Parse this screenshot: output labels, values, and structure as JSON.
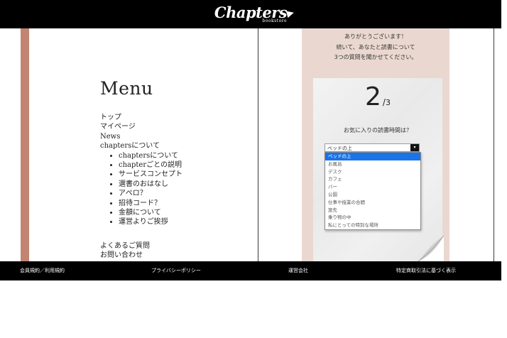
{
  "header": {
    "logo_text": "Chapters",
    "logo_sub": "bookstore"
  },
  "menu": {
    "title": "Menu",
    "items": [
      "トップ",
      "マイページ",
      "News",
      "chaptersについて"
    ],
    "sub_items": [
      "chaptersについて",
      "chapterごとの説明",
      "サービスコンセプト",
      "選書のおはなし",
      "アペロ？",
      "招待コード？",
      "金額について",
      "運営よりご挨拶"
    ],
    "bottom_items": [
      "よくあるご質問",
      "お問い合わせ"
    ]
  },
  "survey": {
    "intro_lines": [
      "ありがとうございます！",
      "続いて、あなたと読書について",
      "3つの質問を聞かせてください。"
    ],
    "step_current": "2",
    "step_sep": "/",
    "step_total": "3",
    "question": "お気に入りの読書時間は？",
    "select_value": "ベッドの上",
    "options": [
      "ベッドの上",
      "お風呂",
      "デスク",
      "カフェ",
      "バー",
      "公園",
      "仕事や授業の合間",
      "旅先",
      "乗り物の中",
      "私にとっての特別な場所"
    ],
    "selected_index": 0
  },
  "footer": {
    "links": [
      "会員規約／利用規約",
      "プライバシーポリシー",
      "運営会社",
      "特定商取引法に基づく表示"
    ]
  },
  "colors": {
    "accent_strip": "#c38472",
    "panel_bg": "#ead8d0",
    "highlight": "#1a73e8"
  }
}
